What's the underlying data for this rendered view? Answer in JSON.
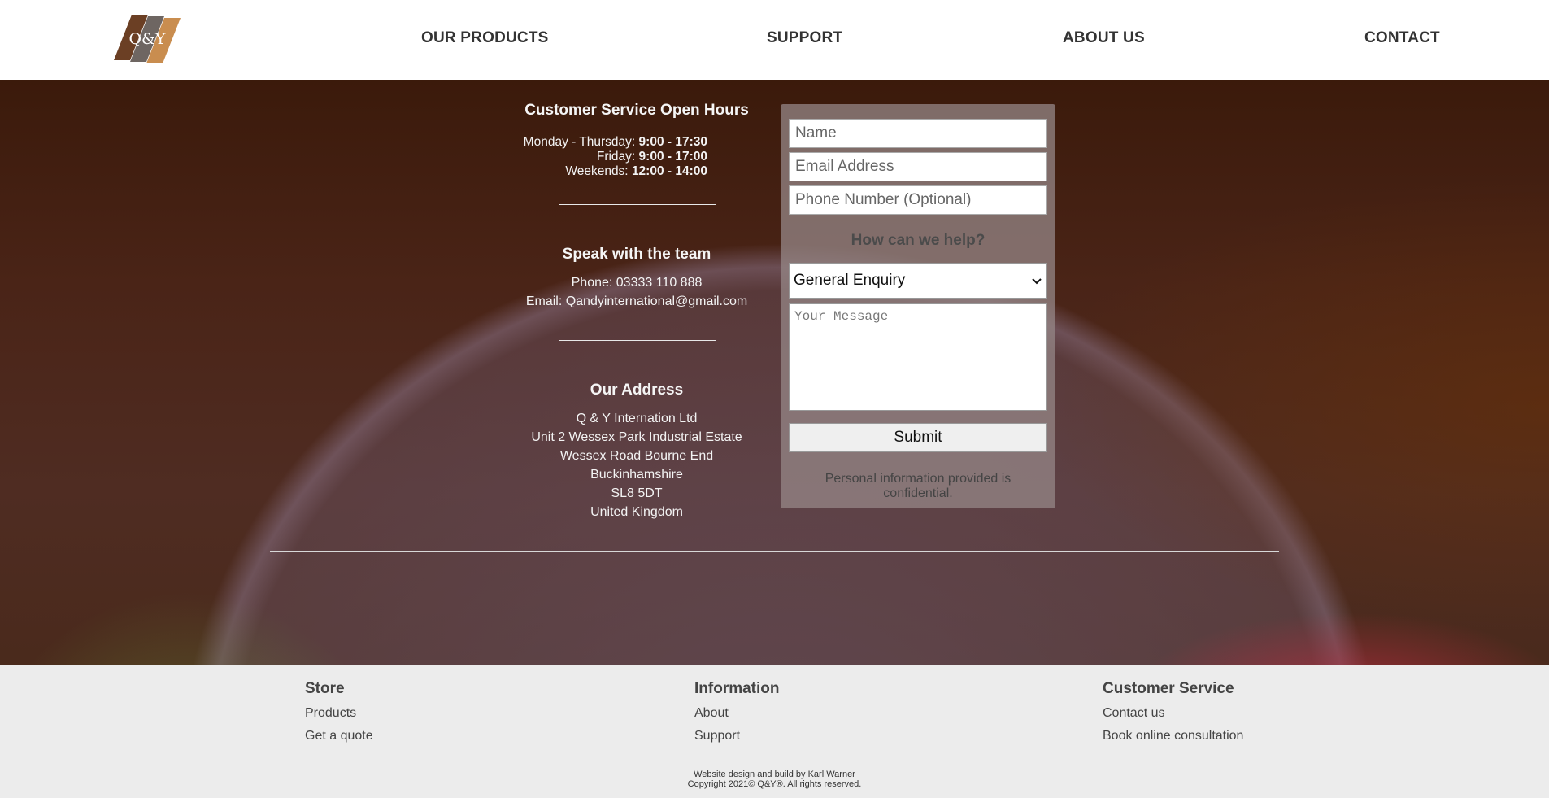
{
  "header": {
    "logo_text": "Q&Y",
    "nav": [
      {
        "label": "OUR PRODUCTS"
      },
      {
        "label": "SUPPORT"
      },
      {
        "label": "ABOUT US"
      },
      {
        "label": "CONTACT"
      }
    ]
  },
  "hours": {
    "heading": "Customer Service Open Hours",
    "rows": [
      {
        "day": "Monday - Thursday: ",
        "time": "9:00 - 17:30"
      },
      {
        "day": "Friday: ",
        "time": "9:00 - 17:00"
      },
      {
        "day": "Weekends: ",
        "time": "12:00 - 14:00"
      }
    ]
  },
  "team": {
    "heading": "Speak with the team",
    "phone": "Phone: 03333 110 888",
    "email": "Email: Qandyinternational@gmail.com"
  },
  "address": {
    "heading": "Our Address",
    "lines": [
      "Q & Y Internation Ltd",
      "Unit 2 Wessex Park Industrial Estate",
      "Wessex Road Bourne End",
      "Buckinhamshire",
      "SL8 5DT",
      "United Kingdom"
    ]
  },
  "form": {
    "name_placeholder": "Name",
    "email_placeholder": "Email Address",
    "phone_placeholder": "Phone Number (Optional)",
    "help_heading": "How can we help?",
    "select_value": "General Enquiry",
    "message_placeholder": "Your Message",
    "submit_label": "Submit",
    "confidential": "Personal information provided is confidential."
  },
  "footer": {
    "columns": [
      {
        "heading": "Store",
        "links": [
          "Products",
          "Get a quote"
        ]
      },
      {
        "heading": "Information",
        "links": [
          "About",
          "Support"
        ]
      },
      {
        "heading": "Customer Service",
        "links": [
          "Contact us",
          "Book online consultation"
        ]
      }
    ],
    "credit_prefix": "Website design and build by ",
    "credit_author": "Karl Warner",
    "copyright": "Copyright 2021© Q&Y®. All rights reserved."
  },
  "colors": {
    "logo_dark": "#6b3f24",
    "logo_mid": "#6e6662",
    "logo_light": "#c98d4f"
  }
}
